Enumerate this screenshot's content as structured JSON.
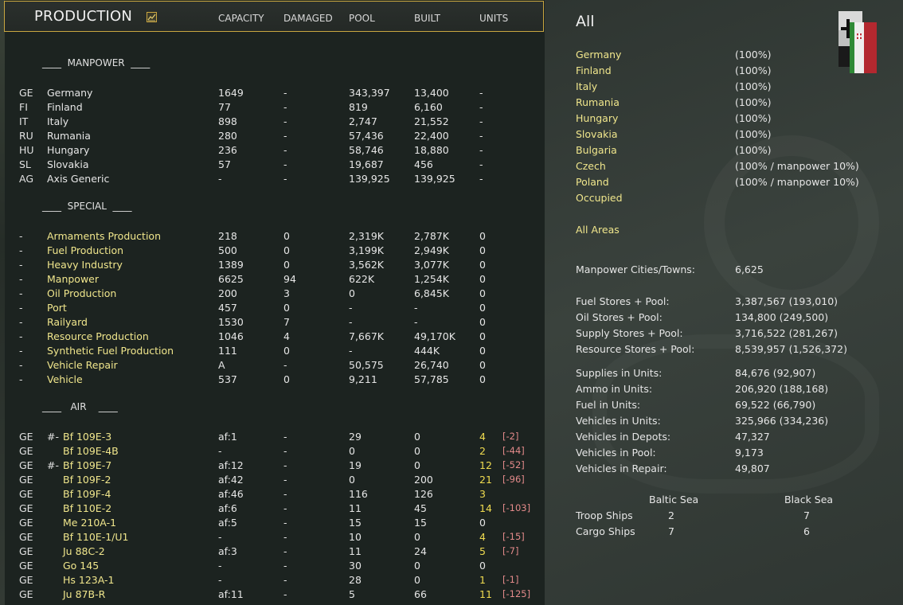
{
  "header": {
    "title": "PRODUCTION",
    "columns": [
      "CAPACITY",
      "DAMAGED",
      "POOL",
      "BUILT",
      "UNITS"
    ]
  },
  "sections": {
    "manpower": "____  MANPOWER  ____",
    "special": "____  SPECIAL  ____",
    "air": "____   AIR    ____"
  },
  "manpower_rows": [
    {
      "code": "GE",
      "name": "Germany",
      "capacity": "1649",
      "damaged": "-",
      "pool": "343,397",
      "built": "13,400",
      "units": "-"
    },
    {
      "code": "FI",
      "name": "Finland",
      "capacity": "77",
      "damaged": "-",
      "pool": "819",
      "built": "6,160",
      "units": "-"
    },
    {
      "code": "IT",
      "name": "Italy",
      "capacity": "898",
      "damaged": "-",
      "pool": "2,747",
      "built": "21,552",
      "units": "-"
    },
    {
      "code": "RU",
      "name": "Rumania",
      "capacity": "280",
      "damaged": "-",
      "pool": "57,436",
      "built": "22,400",
      "units": "-"
    },
    {
      "code": "HU",
      "name": "Hungary",
      "capacity": "236",
      "damaged": "-",
      "pool": "58,746",
      "built": "18,880",
      "units": "-"
    },
    {
      "code": "SL",
      "name": "Slovakia",
      "capacity": "57",
      "damaged": "-",
      "pool": "19,687",
      "built": "456",
      "units": "-"
    },
    {
      "code": "AG",
      "name": "Axis Generic",
      "capacity": "-",
      "damaged": "-",
      "pool": "139,925",
      "built": "139,925",
      "units": "-"
    }
  ],
  "special_rows": [
    {
      "code": "-",
      "name": "Armaments Production",
      "capacity": "218",
      "damaged": "0",
      "pool": "2,319K",
      "built": "2,787K",
      "units": "0"
    },
    {
      "code": "-",
      "name": "Fuel Production",
      "capacity": "500",
      "damaged": "0",
      "pool": "3,199K",
      "built": "2,949K",
      "units": "0"
    },
    {
      "code": "-",
      "name": "Heavy Industry",
      "capacity": "1389",
      "damaged": "0",
      "pool": "3,562K",
      "built": "3,077K",
      "units": "0"
    },
    {
      "code": "-",
      "name": "Manpower",
      "capacity": "6625",
      "damaged": "94",
      "pool": "622K",
      "built": "1,254K",
      "units": "0"
    },
    {
      "code": "-",
      "name": "Oil Production",
      "capacity": "200",
      "damaged": "3",
      "pool": "0",
      "built": "6,845K",
      "units": "0"
    },
    {
      "code": "-",
      "name": "Port",
      "capacity": "457",
      "damaged": "0",
      "pool": "-",
      "built": "-",
      "units": "0"
    },
    {
      "code": "-",
      "name": "Railyard",
      "capacity": "1530",
      "damaged": "7",
      "pool": "-",
      "built": "-",
      "units": "0"
    },
    {
      "code": "-",
      "name": "Resource Production",
      "capacity": "1046",
      "damaged": "4",
      "pool": "7,667K",
      "built": "49,170K",
      "units": "0"
    },
    {
      "code": "-",
      "name": "Synthetic Fuel Production",
      "capacity": "111",
      "damaged": "0",
      "pool": "-",
      "built": "444K",
      "units": "0"
    },
    {
      "code": "-",
      "name": "Vehicle Repair",
      "capacity": "A",
      "damaged": "-",
      "pool": "50,575",
      "built": "26,740",
      "units": "0"
    },
    {
      "code": "-",
      "name": "Vehicle",
      "capacity": "537",
      "damaged": "0",
      "pool": "9,211",
      "built": "57,785",
      "units": "0"
    }
  ],
  "air_rows": [
    {
      "code": "GE",
      "prefix": "#-",
      "name": "Bf 109E-3",
      "capacity": "af:1",
      "damaged": "-",
      "pool": "29",
      "built": "0",
      "units": "4",
      "delta": "[-2]"
    },
    {
      "code": "GE",
      "prefix": "",
      "name": "Bf 109E-4B",
      "capacity": "-",
      "damaged": "-",
      "pool": "0",
      "built": "0",
      "units": "2",
      "delta": "[-44]"
    },
    {
      "code": "GE",
      "prefix": "#-",
      "name": "Bf 109E-7",
      "capacity": "af:12",
      "damaged": "-",
      "pool": "19",
      "built": "0",
      "units": "12",
      "delta": "[-52]"
    },
    {
      "code": "GE",
      "prefix": "",
      "name": "Bf 109F-2",
      "capacity": "af:42",
      "damaged": "-",
      "pool": "0",
      "built": "200",
      "units": "21",
      "delta": "[-96]"
    },
    {
      "code": "GE",
      "prefix": "",
      "name": "Bf 109F-4",
      "capacity": "af:46",
      "damaged": "-",
      "pool": "116",
      "built": "126",
      "units": "3",
      "delta": ""
    },
    {
      "code": "GE",
      "prefix": "",
      "name": "Bf 110E-2",
      "capacity": "af:6",
      "damaged": "-",
      "pool": "11",
      "built": "45",
      "units": "14",
      "delta": "[-103]"
    },
    {
      "code": "GE",
      "prefix": "",
      "name": "Me 210A-1",
      "capacity": "af:5",
      "damaged": "-",
      "pool": "15",
      "built": "15",
      "units": "0",
      "delta": ""
    },
    {
      "code": "GE",
      "prefix": "",
      "name": "Bf 110E-1/U1",
      "capacity": "-",
      "damaged": "-",
      "pool": "10",
      "built": "0",
      "units": "4",
      "delta": "[-15]"
    },
    {
      "code": "GE",
      "prefix": "",
      "name": "Ju 88C-2",
      "capacity": "af:3",
      "damaged": "-",
      "pool": "11",
      "built": "24",
      "units": "5",
      "delta": "[-7]"
    },
    {
      "code": "GE",
      "prefix": "",
      "name": "Go 145",
      "capacity": "-",
      "damaged": "-",
      "pool": "30",
      "built": "0",
      "units": "0",
      "delta": ""
    },
    {
      "code": "GE",
      "prefix": "",
      "name": "Hs 123A-1",
      "capacity": "-",
      "damaged": "-",
      "pool": "28",
      "built": "0",
      "units": "1",
      "delta": "[-1]"
    },
    {
      "code": "GE",
      "prefix": "",
      "name": "Ju 87B-R",
      "capacity": "af:11",
      "damaged": "-",
      "pool": "5",
      "built": "66",
      "units": "11",
      "delta": "[-125]"
    }
  ],
  "summary": {
    "title": "All",
    "nations": [
      {
        "name": "Germany",
        "pct": "(100%)"
      },
      {
        "name": "Finland",
        "pct": "(100%)"
      },
      {
        "name": "Italy",
        "pct": "(100%)"
      },
      {
        "name": "Rumania",
        "pct": "(100%)"
      },
      {
        "name": "Hungary",
        "pct": "(100%)"
      },
      {
        "name": "Slovakia",
        "pct": "(100%)"
      },
      {
        "name": "Bulgaria",
        "pct": "(100%)"
      },
      {
        "name": "Czech",
        "pct": "(100% / manpower 10%)"
      },
      {
        "name": "Poland",
        "pct": "(100% / manpower 10%)"
      },
      {
        "name": "Occupied",
        "pct": ""
      }
    ],
    "all_areas": "All Areas",
    "manpower_cities": {
      "label": "Manpower Cities/Towns:",
      "value": "6,625"
    },
    "stores": [
      {
        "label": "Fuel Stores + Pool:",
        "value": "3,387,567 (193,010)"
      },
      {
        "label": "Oil Stores + Pool:",
        "value": "134,800 (249,500)"
      },
      {
        "label": "Supply Stores + Pool:",
        "value": "3,716,522 (281,267)"
      },
      {
        "label": "Resource Stores + Pool:",
        "value": "8,539,957 (1,526,372)"
      }
    ],
    "units": [
      {
        "label": "Supplies in Units:",
        "value": "84,676 (92,907)"
      },
      {
        "label": "Ammo in Units:",
        "value": "206,920 (188,168)"
      },
      {
        "label": "Fuel in Units:",
        "value": "69,522 (66,790)"
      },
      {
        "label": "Vehicles in Units:",
        "value": "325,966 (334,236)"
      },
      {
        "label": "Vehicles in Depots:",
        "value": "47,327"
      },
      {
        "label": "Vehicles in Pool:",
        "value": "9,173"
      },
      {
        "label": "Vehicles in Repair:",
        "value": "49,807"
      }
    ],
    "seas": {
      "headers": [
        "Baltic Sea",
        "Black Sea"
      ],
      "rows": [
        {
          "label": "Troop Ships",
          "baltic": "2",
          "black": "7"
        },
        {
          "label": "Cargo Ships",
          "baltic": "7",
          "black": "6"
        }
      ]
    }
  },
  "colors": {
    "accent_border": "#c9a640",
    "highlight_text": "#f0e68c",
    "loss_text": "#e38a8a",
    "panel_bg": "#1c2320"
  }
}
